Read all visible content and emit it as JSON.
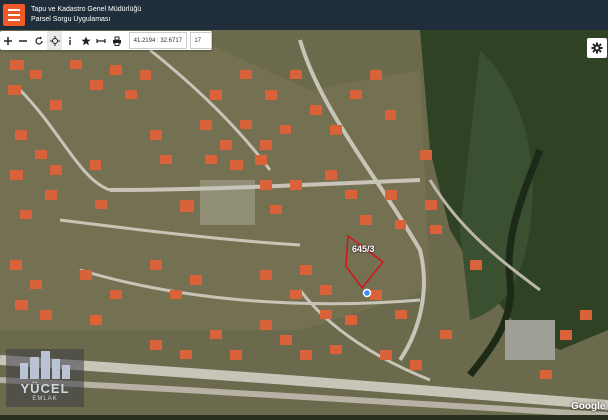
{
  "header": {
    "title": "Tapu ve Kadastro Genel Müdürlüğü",
    "subtitle": "Parsel Sorgu Uygulaması"
  },
  "toolbar": {
    "coordinates": "41.2194 : 32.6717",
    "zoom": "17",
    "buttons": [
      "zoom-in-icon",
      "zoom-out-icon",
      "refresh-icon",
      "locate-icon",
      "info-icon",
      "star-icon",
      "measure-icon",
      "print-icon"
    ]
  },
  "map": {
    "parcel_label": "645/3",
    "watermark_brand": "YÜCEL",
    "watermark_sub": "EMLAK",
    "attribution": "Google"
  },
  "colors": {
    "header_bg": "#1f2e3a",
    "logo_bg": "#f05a28",
    "roof": "#d9623a",
    "road": "#c8c4b8"
  }
}
